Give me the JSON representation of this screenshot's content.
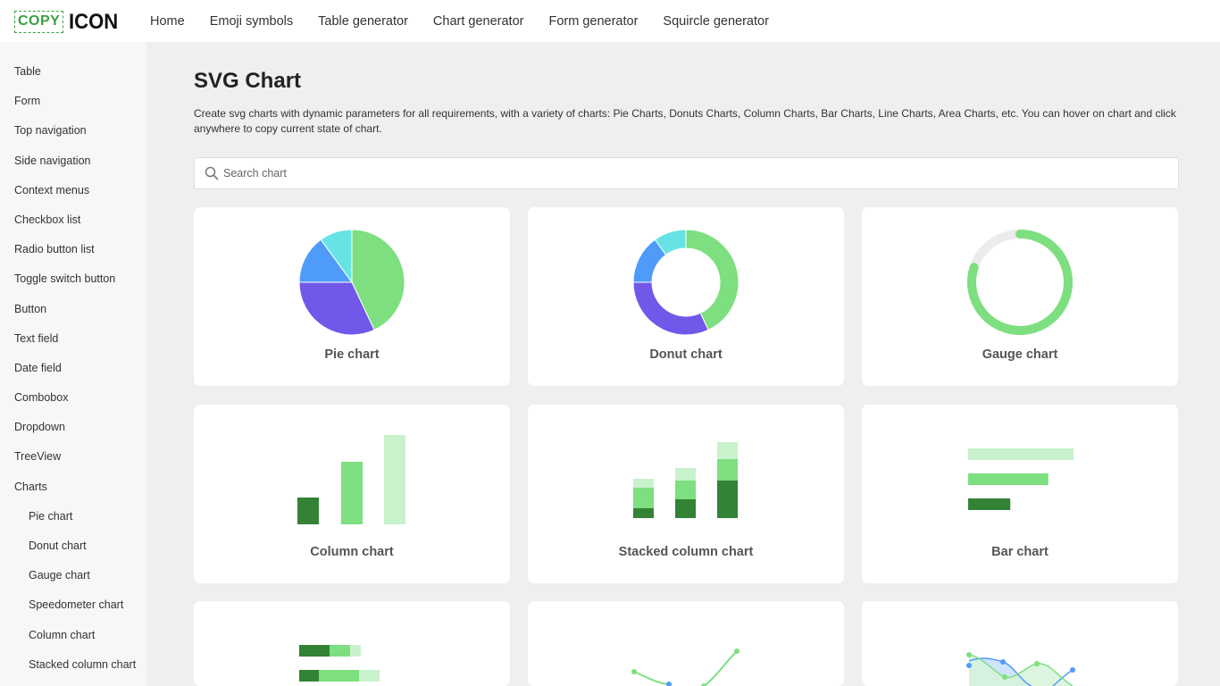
{
  "logo": {
    "part1": "COPY",
    "part2": "ICON"
  },
  "topnav": [
    "Home",
    "Emoji symbols",
    "Table generator",
    "Chart generator",
    "Form generator",
    "Squircle generator"
  ],
  "sidebar": [
    "Table",
    "Form",
    "Top navigation",
    "Side navigation",
    "Context menus",
    "Checkbox list",
    "Radio button list",
    "Toggle switch button",
    "Button",
    "Text field",
    "Date field",
    "Combobox",
    "Dropdown",
    "TreeView",
    "Charts"
  ],
  "sidebar_sub": [
    "Pie chart",
    "Donut chart",
    "Gauge chart",
    "Speedometer chart",
    "Column chart",
    "Stacked column chart"
  ],
  "main": {
    "title": "SVG Chart",
    "description": "Create svg charts with dynamic parameters for all requirements, with a variety of charts: Pie Charts, Donuts Charts, Column Charts, Bar Charts, Line Charts, Area Charts, etc. You can hover on chart and click anywhere to copy current state of chart.",
    "search_placeholder": "Search chart"
  },
  "cards": [
    {
      "label": "Pie chart"
    },
    {
      "label": "Donut chart"
    },
    {
      "label": "Gauge chart"
    },
    {
      "label": "Column chart"
    },
    {
      "label": "Stacked column chart"
    },
    {
      "label": "Bar chart"
    },
    {
      "label": ""
    },
    {
      "label": ""
    },
    {
      "label": ""
    }
  ],
  "colors": {
    "brand_green": "#3aa043",
    "light_green": "#7ddf7f",
    "pale_green": "#c8f2cc",
    "dark_green": "#338236",
    "purple": "#7258e8",
    "blue": "#4f9bfa",
    "teal": "#68e3e3",
    "gauge_track": "#ececec"
  },
  "icons": {
    "search": "search-icon"
  },
  "preview_values": {
    "pie": [
      43,
      32,
      15,
      10
    ],
    "donut": [
      43,
      32,
      15,
      10
    ],
    "gauge": 80,
    "column": [
      30,
      70,
      100
    ],
    "stacked_column": [
      [
        11,
        23,
        10
      ],
      [
        21,
        21,
        14
      ],
      [
        42,
        24,
        19
      ]
    ],
    "bar": [
      100,
      76,
      40
    ],
    "stacked_bar": [
      [
        34,
        23,
        12
      ],
      [
        22,
        45,
        23
      ]
    ]
  }
}
